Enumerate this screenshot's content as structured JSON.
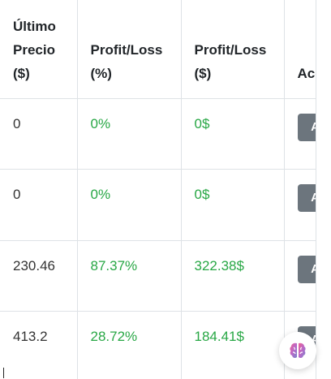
{
  "table": {
    "headers": [
      {
        "line1": "Último",
        "line2": "Precio",
        "line3": "($)"
      },
      {
        "line1": "",
        "line2": "Profit/Loss",
        "line3": "(%)"
      },
      {
        "line1": "",
        "line2": "Profit/Loss",
        "line3": "($)"
      },
      {
        "line1": "",
        "line2": "",
        "line3": "Acciones"
      }
    ],
    "rows": [
      {
        "price": "0",
        "pl_pct": "0%",
        "pl_usd": "0$",
        "action": "Ar"
      },
      {
        "price": "0",
        "pl_pct": "0%",
        "pl_usd": "0$",
        "action": "Ar"
      },
      {
        "price": "230.46",
        "pl_pct": "87.37%",
        "pl_usd": "322.38$",
        "action": "Ar"
      },
      {
        "price": "413.2",
        "pl_pct": "28.72%",
        "pl_usd": "184.41$",
        "action": "Ar"
      }
    ]
  },
  "colors": {
    "positive": "#28a745",
    "button": "#6c757d",
    "border": "#dee2e6"
  },
  "floating_button": {
    "icon": "brain-icon"
  }
}
